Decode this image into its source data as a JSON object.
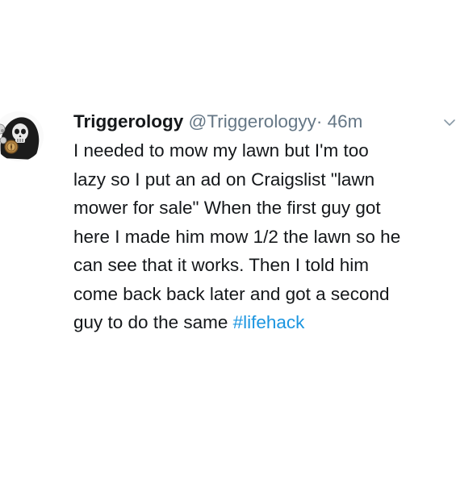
{
  "tweet": {
    "author": {
      "display_name": "Triggerology",
      "handle": "@Triggerologyy",
      "avatar_icon": "skull-reaper-avatar-icon"
    },
    "separator": "·",
    "timestamp": "46m",
    "menu_icon": "chevron-down-icon",
    "body_lines": [
      "I needed to mow my lawn but I'm too",
      "lazy so I put an ad on Craigslist \"lawn",
      "mower for sale\" When the first guy got",
      "here I made him mow 1/2 the lawn so he",
      "can see that it works. Then I told him",
      "come back back later and got a second",
      "guy to do the same "
    ],
    "hashtag": "#lifehack",
    "colors": {
      "text": "#14171a",
      "secondary": "#657786",
      "link": "#1b95e0",
      "background": "#ffffff"
    }
  }
}
